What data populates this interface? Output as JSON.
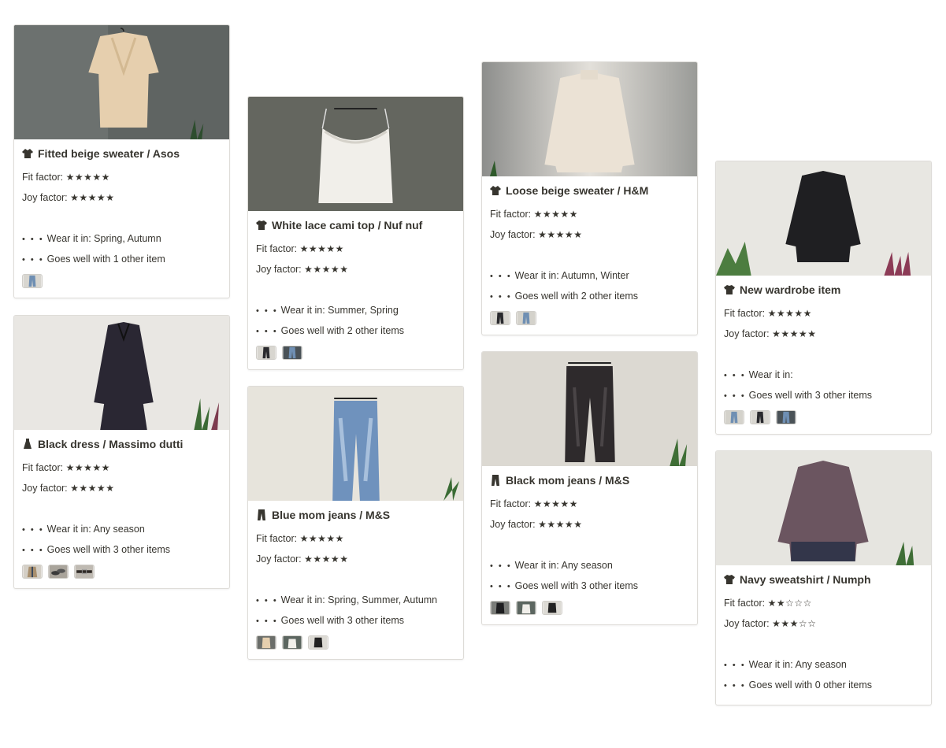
{
  "cards": [
    {
      "title": "Fitted beige sweater / Asos",
      "icon": "sweater-icon",
      "fit_label": "Fit factor:",
      "fit_stars": "★★★★★",
      "joy_label": "Joy factor:",
      "joy_stars": "★★★★★",
      "wear_dots": "• • •",
      "wear": "Wear it in: Spring, Autumn",
      "goes": "Goes well with 1 other item",
      "thumbs": [
        "blue-jeans"
      ]
    },
    {
      "title": "Black dress / Massimo dutti",
      "icon": "dress-icon",
      "fit_label": "Fit factor:",
      "fit_stars": "★★★★★",
      "joy_label": "Joy factor:",
      "joy_stars": "★★★★★",
      "wear_dots": "• • •",
      "wear": "Wear it in: Any season",
      "goes": "Goes well with 3 other items",
      "thumbs": [
        "trench",
        "sneakers",
        "belt"
      ]
    },
    {
      "title": "White lace cami top / Nuf nuf",
      "icon": "shirt-icon",
      "fit_label": "Fit factor:",
      "fit_stars": "★★★★★",
      "joy_label": "Joy factor:",
      "joy_stars": "★★★★★",
      "wear_dots": "• • •",
      "wear": "Wear it in: Summer, Spring",
      "goes": "Goes well with 2 other items",
      "thumbs": [
        "black-jeans",
        "blue-jeans"
      ]
    },
    {
      "title": "Blue mom jeans / M&S",
      "icon": "jeans-icon",
      "fit_label": "Fit factor:",
      "fit_stars": "★★★★★",
      "joy_label": "Joy factor:",
      "joy_stars": "★★★★★",
      "wear_dots": "• • •",
      "wear": "Wear it in: Spring, Summer, Autumn",
      "goes": "Goes well with 3 other items",
      "thumbs": [
        "beige-sweater",
        "cami",
        "black-top"
      ]
    },
    {
      "title": "Loose beige sweater / H&M",
      "icon": "sweater-icon",
      "fit_label": "Fit factor:",
      "fit_stars": "★★★★★",
      "joy_label": "Joy factor:",
      "joy_stars": "★★★★★",
      "wear_dots": "• • •",
      "wear": "Wear it in: Autumn, Winter",
      "goes": "Goes well with 2 other items",
      "thumbs": [
        "black-jeans",
        "blue-jeans"
      ]
    },
    {
      "title": "Black mom jeans / M&S",
      "icon": "jeans-icon",
      "fit_label": "Fit factor:",
      "fit_stars": "★★★★★",
      "joy_label": "Joy factor:",
      "joy_stars": "★★★★★",
      "wear_dots": "• • •",
      "wear": "Wear it in: Any season",
      "goes": "Goes well with 3 other items",
      "thumbs": [
        "black-top",
        "cami",
        "black-top"
      ]
    },
    {
      "title": "New wardrobe item",
      "icon": "shirt-icon",
      "fit_label": "Fit factor:",
      "fit_stars": "★★★★★",
      "joy_label": "Joy factor:",
      "joy_stars": "★★★★★",
      "wear_dots": "• • •",
      "wear": "Wear it in:",
      "goes": "Goes well with 3 other items",
      "thumbs": [
        "blue-jeans",
        "black-jeans",
        "blue-jeans"
      ]
    },
    {
      "title": "Navy sweatshirt / Numph",
      "icon": "shirt-icon",
      "fit_label": "Fit factor:",
      "fit_stars": "★★☆☆☆",
      "joy_label": "Joy factor:",
      "joy_stars": "★★★☆☆",
      "wear_dots": "• • •",
      "wear": "Wear it in: Any season",
      "goes": "Goes well with 0 other items",
      "thumbs": []
    }
  ]
}
